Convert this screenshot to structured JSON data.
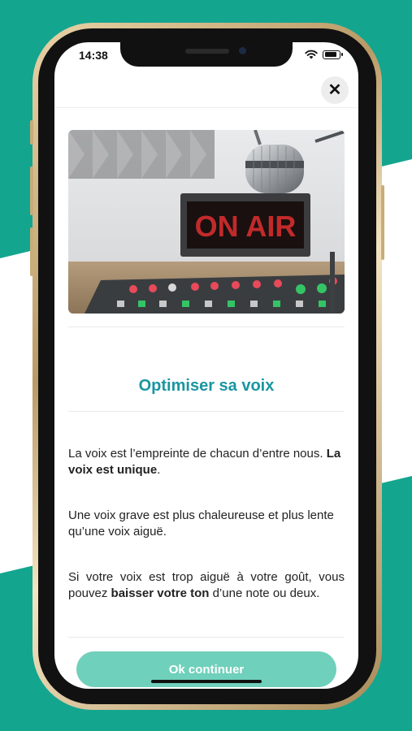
{
  "brand_color": "#14a58f",
  "status_bar": {
    "time": "14:38"
  },
  "modal": {
    "close_icon": "close-icon",
    "hero_image": "studio-on-air",
    "hero_sign_text": "ON AIR",
    "title": "Optimiser sa voix",
    "title_color": "#1a96a1",
    "paragraphs": [
      {
        "before": "La voix est l’empreinte de chacun d’entre nous. ",
        "bold": "La voix est unique",
        "after": "."
      },
      {
        "before": "Une voix grave est plus chaleureuse et plus lente qu’une voix aiguë.",
        "bold": "",
        "after": ""
      },
      {
        "before": "Si votre voix est trop aiguë à votre goût, vous pouvez ",
        "bold": "baisser votre ton",
        "after": " d’une note ou deux."
      }
    ],
    "cta_label": "Ok continuer",
    "cta_color": "#6fd0bb"
  }
}
